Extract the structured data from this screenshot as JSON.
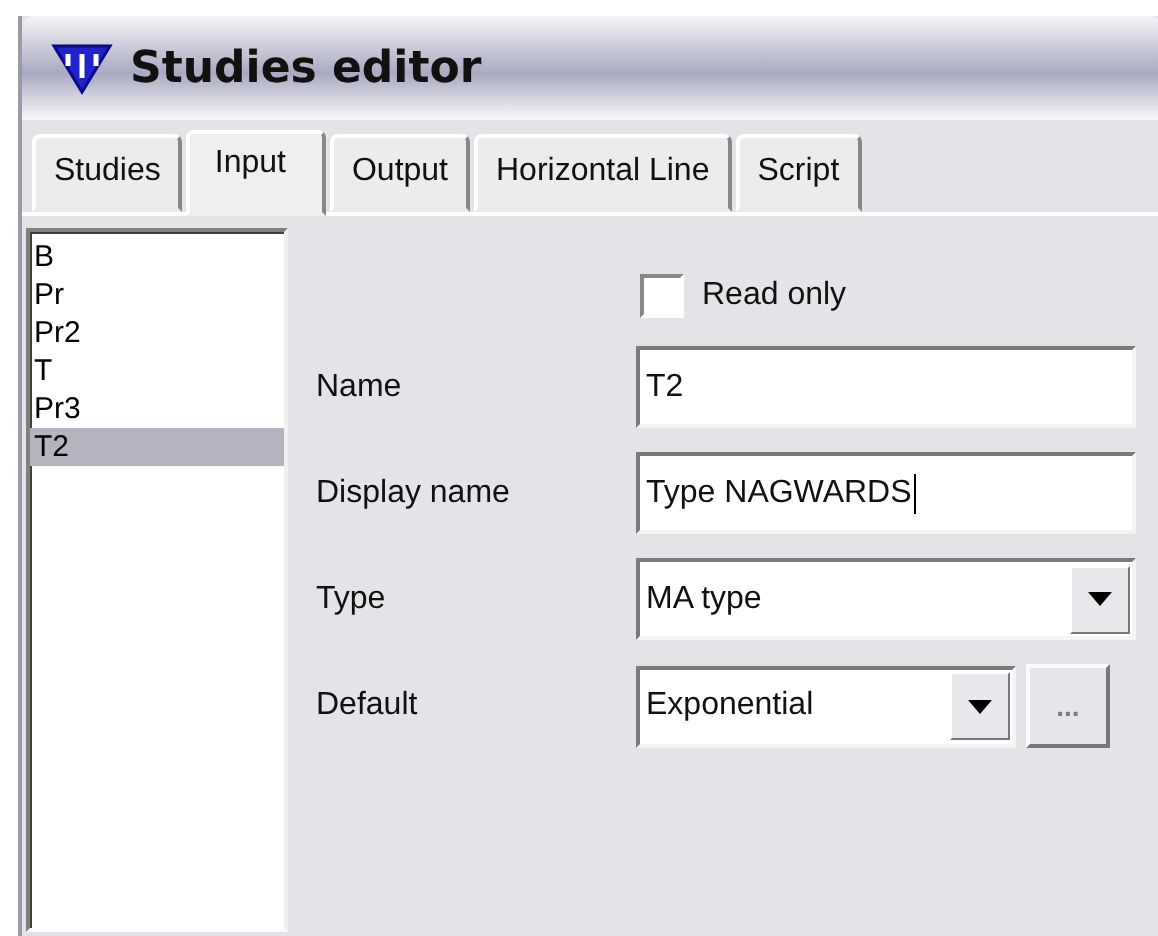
{
  "window": {
    "title": "Studies editor"
  },
  "tabs": [
    {
      "label": "Studies",
      "selected": false
    },
    {
      "label": "Input",
      "selected": true
    },
    {
      "label": "Output",
      "selected": false
    },
    {
      "label": "Horizontal Line",
      "selected": false
    },
    {
      "label": "Script",
      "selected": false
    }
  ],
  "inputs_list": [
    {
      "label": "B",
      "selected": false
    },
    {
      "label": "Pr",
      "selected": false
    },
    {
      "label": "Pr2",
      "selected": false
    },
    {
      "label": "T",
      "selected": false
    },
    {
      "label": "Pr3",
      "selected": false
    },
    {
      "label": "T2",
      "selected": true
    }
  ],
  "read_only": {
    "label": "Read only",
    "checked": false
  },
  "form": [
    {
      "kind": "text",
      "label": "Name",
      "value": "T2",
      "caret": false
    },
    {
      "kind": "text",
      "label": "Display name",
      "value": "Type NAGWARDS",
      "caret": true
    },
    {
      "kind": "combo",
      "label": "Type",
      "value": "MA type"
    },
    {
      "kind": "combo_button",
      "label": "Default",
      "value": "Exponential",
      "button": {
        "label": "...",
        "disabled": true
      }
    }
  ]
}
